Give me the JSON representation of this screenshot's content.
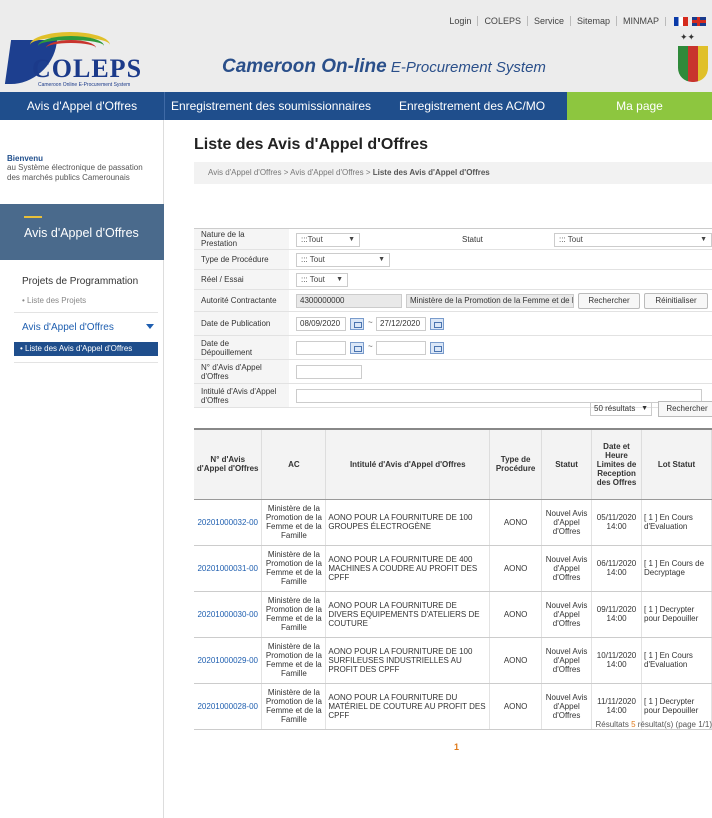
{
  "toplinks": [
    "Login",
    "COLEPS",
    "Service",
    "Sitemap",
    "MINMAP"
  ],
  "logo": {
    "word": "COLEPS",
    "tagline": "Cameroon Online E-Procurement System"
  },
  "site_title": {
    "bold": "Cameroon On-line",
    "rest": " E-Procurement System"
  },
  "nav": [
    "Avis d'Appel d'Offres",
    "Enregistrement des soumissionnaires",
    "Enregistrement des AC/MO",
    "Ma page"
  ],
  "sidebar": {
    "welcome_title": "Bienvenu",
    "welcome_text": "au Système électronique de passation des marchés publics Camerounais",
    "banner": "Avis d'Appel d'Offres",
    "section1": "Projets de Programmation",
    "section1_sub": "• Liste des Projets",
    "section2": "Avis d'Appel d'Offres",
    "active_item": "• Liste des Avis d'Appel d'Offres"
  },
  "page_title": "Liste des Avis d'Appel d'Offres",
  "breadcrumb": {
    "trail": "Avis d'Appel d'Offres > Avis d'Appel d'Offres > ",
    "current": "Liste des Avis d'Appel d'Offres"
  },
  "form": {
    "nature_label": "Nature de la Prestation",
    "nature_value": ":::Tout",
    "statut_label": "Statut",
    "statut_value": "::: Tout",
    "procedure_label": "Type de Procédure",
    "procedure_value": "::: Tout",
    "reel_label": "Réel / Essai",
    "reel_value": "::: Tout",
    "autorite_label": "Autorité Contractante",
    "autorite_code": "4300000000",
    "autorite_name": "Ministère de la Promotion de la Femme et de la Famille",
    "search_label": "Rechercher",
    "reset_label": "Réinitialiser",
    "pub_label": "Date de Publication",
    "pub_from": "08/09/2020",
    "pub_to": "27/12/2020",
    "depot_label": "Date de Dépouillement",
    "num_label": "N° d'Avis d'Appel d'Offres",
    "intitule_label": "Intitulé d'Avis d'Appel d'Offres"
  },
  "results_select": "50 résultats",
  "search_button2": "Rechercher",
  "table": {
    "headers": [
      "N° d'Avis d'Appel d'Offres",
      "AC",
      "Intitulé d'Avis d'Appel d'Offres",
      "Type de Procédure",
      "Statut",
      "Date et Heure Limites de Reception des Offres",
      "Lot Statut"
    ],
    "rows": [
      {
        "num": "20201000032-00",
        "ac": "Ministère de la Promotion de la Femme et de la Famille",
        "title": "AONO POUR LA FOURNITURE DE 100 GROUPES ÉLECTROGÈNE",
        "type": "AONO",
        "statut": "Nouvel Avis d'Appel d'Offres",
        "date": "05/11/2020 14:00",
        "lot": "[ 1 ] En Cours d'Evaluation"
      },
      {
        "num": "20201000031-00",
        "ac": "Ministère de la Promotion de la Femme et de la Famille",
        "title": "AONO POUR LA FOURNITURE DE 400 MACHINES A COUDRE AU PROFIT DES CPFF",
        "type": "AONO",
        "statut": "Nouvel Avis d'Appel d'Offres",
        "date": "06/11/2020 14:00",
        "lot": "[ 1 ] En Cours de Decryptage"
      },
      {
        "num": "20201000030-00",
        "ac": "Ministère de la Promotion de la Femme et de la Famille",
        "title": "AONO POUR LA FOURNITURE DE DIVERS EQUIPEMENTS D'ATELIERS DE COUTURE",
        "type": "AONO",
        "statut": "Nouvel Avis d'Appel d'Offres",
        "date": "09/11/2020 14:00",
        "lot": "[ 1 ] Decrypter pour Depouiller"
      },
      {
        "num": "20201000029-00",
        "ac": "Ministère de la Promotion de la Femme et de la Famille",
        "title": "AONO POUR LA FOURNITURE DE 100 SURFILEUSES INDUSTRIELLES AU PROFIT DES CPFF",
        "type": "AONO",
        "statut": "Nouvel Avis d'Appel d'Offres",
        "date": "10/11/2020 14:00",
        "lot": "[ 1 ] En Cours d'Evaluation"
      },
      {
        "num": "20201000028-00",
        "ac": "Ministère de la Promotion de la Femme et de la Famille",
        "title": "AONO POUR LA FOURNITURE DU MATÉRIEL DE COUTURE AU PROFIT DES CPFF",
        "type": "AONO",
        "statut": "Nouvel Avis d'Appel d'Offres",
        "date": "11/11/2020 14:00",
        "lot": "[ 1 ] Decrypter pour Depouiller"
      }
    ]
  },
  "footer": {
    "prefix": "Résultats ",
    "count": "5",
    "suffix": " résultat(s) (page 1/1)"
  },
  "pager": "1",
  "colors": {
    "nav": "#1f4e8c",
    "mypage": "#8dc63f",
    "link": "#1f5fb0",
    "accent": "#e07a1a"
  }
}
